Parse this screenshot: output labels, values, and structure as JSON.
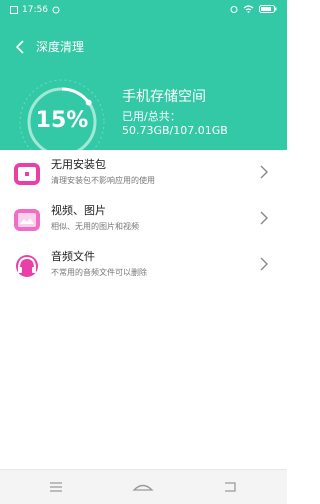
{
  "status_bar": {
    "time": "17:56"
  },
  "header": {
    "title": "深度清理",
    "percent": "15%",
    "percent_value": 15,
    "storage_title": "手机存储空间",
    "storage_usage": "已用/总共：50.73GB/107.01GB"
  },
  "items": [
    {
      "icon": "package-icon",
      "title": "无用安装包",
      "desc": "清理安装包不影响应用的使用"
    },
    {
      "icon": "image-icon",
      "title": "视频、图片",
      "desc": "相似、无用的图片和视频"
    },
    {
      "icon": "headphones-icon",
      "title": "音频文件",
      "desc": "不常用的音频文件可以删除"
    }
  ],
  "colors": {
    "accent": "#34c9a6",
    "icon_pink": "#e940a8"
  }
}
